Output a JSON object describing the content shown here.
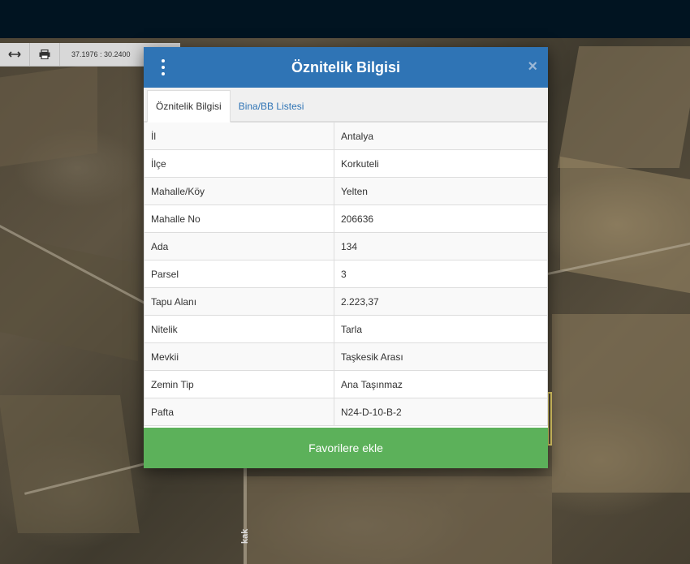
{
  "toolbar": {
    "coordinates": "37.1976 : 30.2400",
    "buttons": [
      {
        "icon": "horizontal-arrows-icon"
      },
      {
        "icon": "print-icon"
      }
    ]
  },
  "modal": {
    "title": "Öznitelik Bilgisi",
    "tabs": [
      {
        "label": "Öznitelik Bilgisi",
        "active": true
      },
      {
        "label": "Bina/BB Listesi",
        "active": false
      }
    ],
    "rows": [
      {
        "key": "İl",
        "value": "Antalya"
      },
      {
        "key": "İlçe",
        "value": "Korkuteli"
      },
      {
        "key": "Mahalle/Köy",
        "value": "Yelten"
      },
      {
        "key": "Mahalle No",
        "value": "206636"
      },
      {
        "key": "Ada",
        "value": "134"
      },
      {
        "key": "Parsel",
        "value": "3"
      },
      {
        "key": "Tapu Alanı",
        "value": "2.223,37"
      },
      {
        "key": "Nitelik",
        "value": "Tarla"
      },
      {
        "key": "Mevkii",
        "value": "Taşkesik Arası"
      },
      {
        "key": "Zemin Tip",
        "value": "Ana Taşınmaz"
      },
      {
        "key": "Pafta",
        "value": "N24-D-10-B-2"
      }
    ],
    "favorite_button": "Favorilere ekle"
  },
  "map": {
    "street_label": "kak"
  },
  "colors": {
    "header": "#2f74b5",
    "favorite": "#5cb15a",
    "topbar": "#011421"
  }
}
